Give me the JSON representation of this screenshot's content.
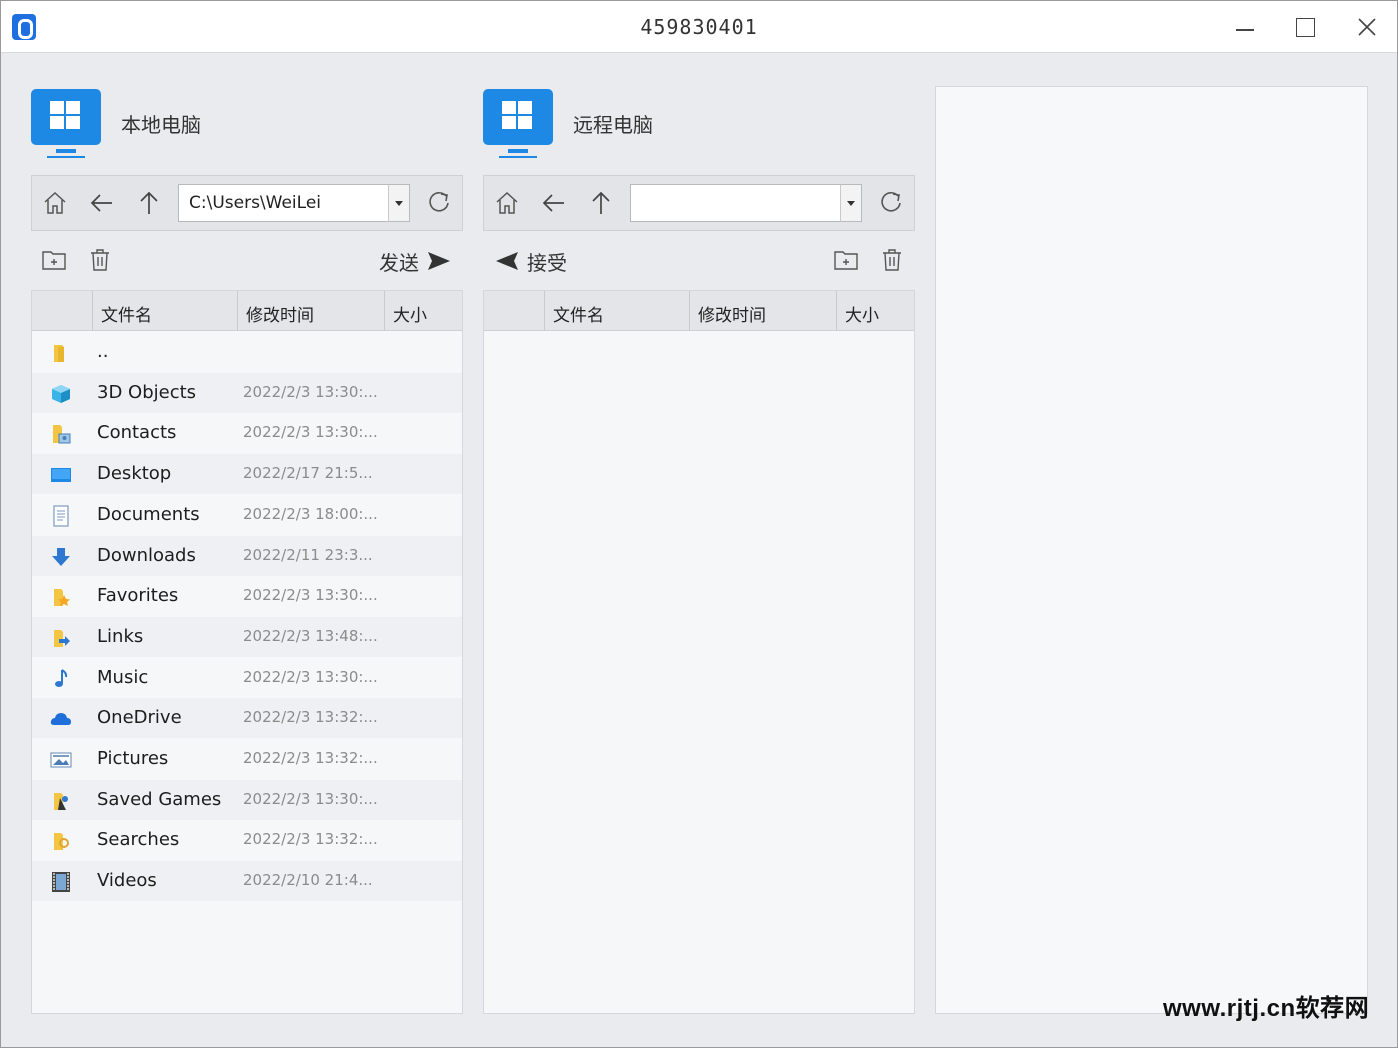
{
  "window": {
    "title": "459830401"
  },
  "local": {
    "title": "本地电脑",
    "path": "C:\\Users\\WeiLei",
    "send_label": "发送",
    "columns": [
      "文件名",
      "修改时间",
      "大小"
    ],
    "files": [
      {
        "name": "..",
        "date": "",
        "icon": "folder-icon"
      },
      {
        "name": "3D Objects",
        "date": "2022/2/3 13:30:...",
        "icon": "3d-objects-icon"
      },
      {
        "name": "Contacts",
        "date": "2022/2/3 13:30:...",
        "icon": "contacts-icon"
      },
      {
        "name": "Desktop",
        "date": "2022/2/17 21:5...",
        "icon": "desktop-icon"
      },
      {
        "name": "Documents",
        "date": "2022/2/3 18:00:...",
        "icon": "documents-icon"
      },
      {
        "name": "Downloads",
        "date": "2022/2/11 23:3...",
        "icon": "downloads-icon"
      },
      {
        "name": "Favorites",
        "date": "2022/2/3 13:30:...",
        "icon": "favorites-icon"
      },
      {
        "name": "Links",
        "date": "2022/2/3 13:48:...",
        "icon": "links-icon"
      },
      {
        "name": "Music",
        "date": "2022/2/3 13:30:...",
        "icon": "music-icon"
      },
      {
        "name": "OneDrive",
        "date": "2022/2/3 13:32:...",
        "icon": "onedrive-icon"
      },
      {
        "name": "Pictures",
        "date": "2022/2/3 13:32:...",
        "icon": "pictures-icon"
      },
      {
        "name": "Saved Games",
        "date": "2022/2/3 13:30:...",
        "icon": "saved-games-icon"
      },
      {
        "name": "Searches",
        "date": "2022/2/3 13:32:...",
        "icon": "searches-icon"
      },
      {
        "name": "Videos",
        "date": "2022/2/10 21:4...",
        "icon": "videos-icon"
      }
    ]
  },
  "remote": {
    "title": "远程电脑",
    "path": "",
    "receive_label": "接受",
    "columns": [
      "文件名",
      "修改时间",
      "大小"
    ]
  },
  "watermark": "www.rjtj.cn软荐网",
  "colors": {
    "accent": "#1e88e5",
    "background": "#eaebee",
    "panel": "#f6f7f9",
    "date_text": "#8b8b8b"
  }
}
